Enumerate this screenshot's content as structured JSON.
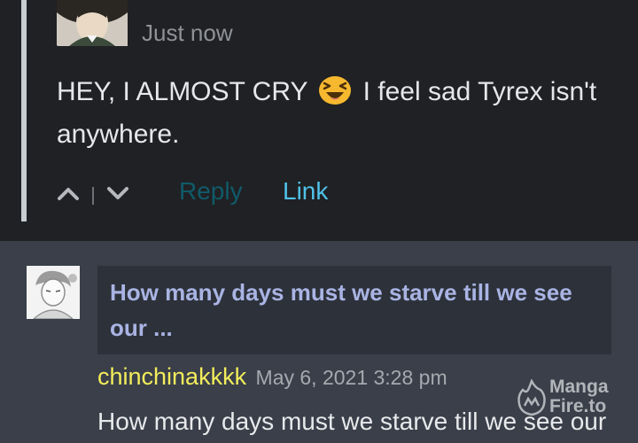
{
  "top_comment": {
    "timestamp": "Just now",
    "text_before_emoji": "HEY, I ALMOST CRY",
    "emoji": "laughing-squint-emoji",
    "text_after_emoji": "I feel sad Tyrex isn't anywhere.",
    "actions": {
      "upvote_icon": "chevron-up-icon",
      "downvote_icon": "chevron-down-icon",
      "reply_label": "Reply",
      "link_label": "Link"
    }
  },
  "reply_comment": {
    "quote": "How many days must we starve till we see our ...",
    "author": "chinchinakkkk",
    "date": "May 6, 2021 3:28 pm",
    "text": "How many days must we starve till we see our"
  },
  "watermark": {
    "line1": "Manga",
    "line2": "Fire.to"
  },
  "colors": {
    "top_background": "#202124",
    "bottom_background": "#3a3f4a",
    "quote_background": "#2d313a",
    "link": "#4fc2e8",
    "author": "#f3ec5b",
    "quote_text": "#a9b4e3"
  }
}
